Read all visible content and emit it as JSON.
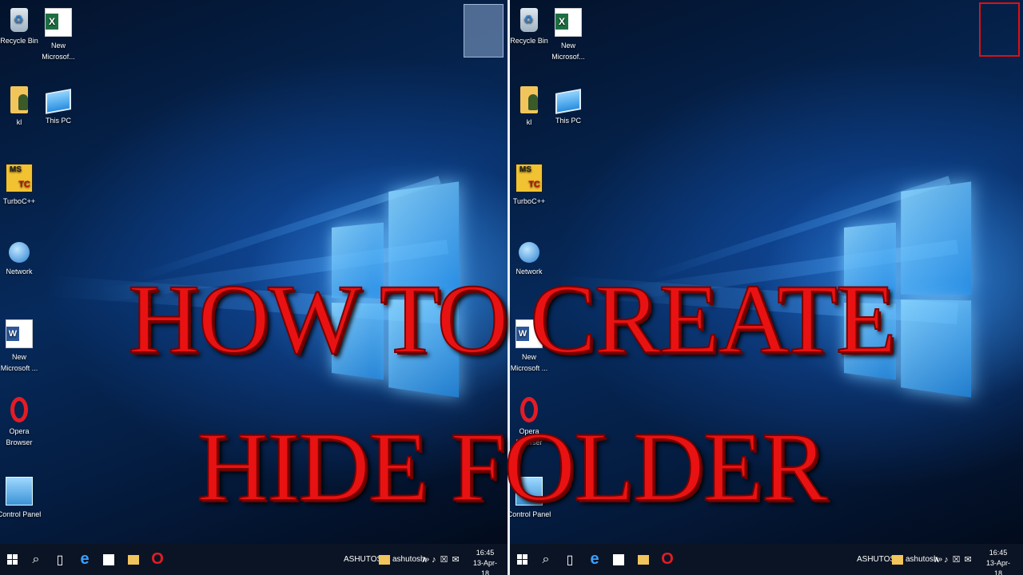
{
  "title": {
    "line1": "HOW TO CREATE",
    "line2": "HIDE FOLDER",
    "color": "#e81212"
  },
  "desktop_icons": [
    {
      "label": "Recycle Bin",
      "icon": "recycle-bin-icon"
    },
    {
      "label": "New Microsof...",
      "icon": "excel-icon"
    },
    {
      "label": "kl",
      "icon": "user-folder-icon"
    },
    {
      "label": "This PC",
      "icon": "this-pc-icon"
    },
    {
      "label": "TurboC++",
      "icon": "turbo-c-icon"
    },
    {
      "label": "Network",
      "icon": "network-icon"
    },
    {
      "label": "New Microsoft ...",
      "icon": "word-icon"
    },
    {
      "label": "Opera Browser",
      "icon": "opera-icon"
    },
    {
      "label": "Control Panel",
      "icon": "control-panel-icon"
    }
  ],
  "taskbar": {
    "search": "⌕",
    "task_view": "▯",
    "user_label": "ASHUTOSH",
    "toolbar_label": "ashutosh",
    "overflow": "»",
    "tray_up": "∧",
    "volume": "♪",
    "network": "☒",
    "notifications": "✉",
    "time": "16:45",
    "date": "13-Apr-18"
  },
  "colors": {
    "taskbar": "#0b1424",
    "selection_highlight": "#8caad2",
    "red_box": "#e01010"
  }
}
